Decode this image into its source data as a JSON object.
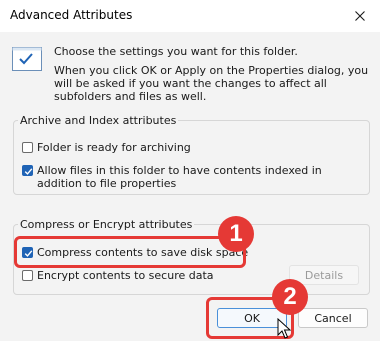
{
  "window": {
    "title": "Advanced Attributes",
    "close_icon": "close-icon"
  },
  "intro": {
    "line1": "Choose the settings you want for this folder.",
    "line2": "When you click OK or Apply on the Properties dialog, you will be asked if you want the changes to affect all subfolders and files as well.",
    "icon": "folder-settings-icon"
  },
  "archive_group": {
    "legend": "Archive and Index attributes",
    "folder_ready_label": "Folder is ready for archiving",
    "folder_ready_checked": false,
    "allow_index_label": "Allow files in this folder to have contents indexed in addition to file properties",
    "allow_index_checked": true
  },
  "compress_group": {
    "legend": "Compress or Encrypt attributes",
    "compress_label": "Compress contents to save disk space",
    "compress_checked": true,
    "encrypt_label": "Encrypt contents to secure data",
    "encrypt_checked": false,
    "details_label": "Details"
  },
  "buttons": {
    "ok_label": "OK",
    "cancel_label": "Cancel"
  },
  "annotations": {
    "step1": "1",
    "step2": "2",
    "color": "#e53935"
  },
  "colors": {
    "accent": "#1f63b5",
    "content_bg": "#f3f3f3"
  }
}
